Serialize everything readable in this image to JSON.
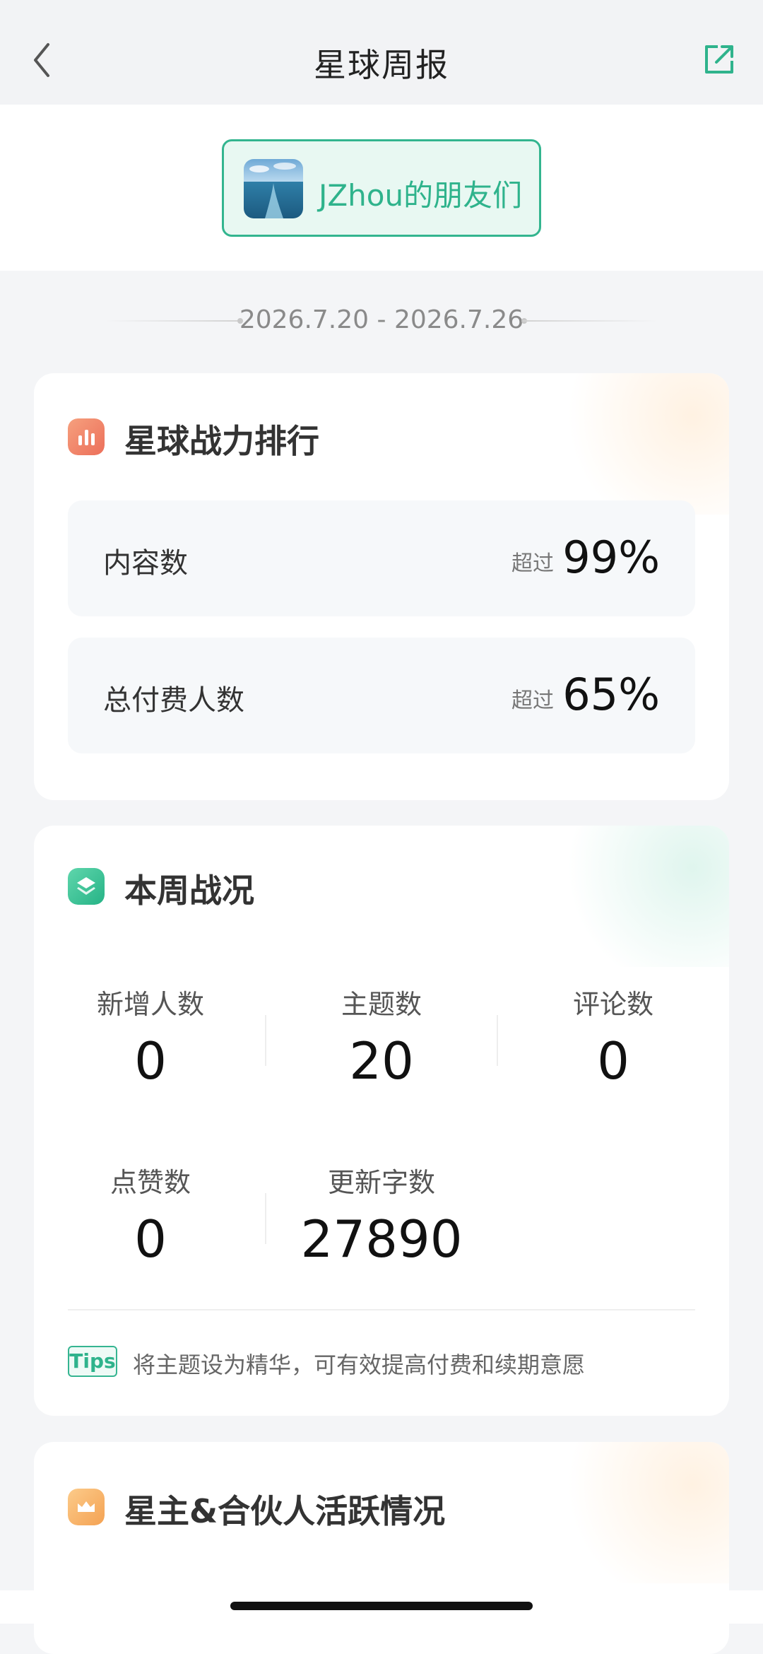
{
  "nav": {
    "title": "星球周报",
    "back_icon": "chevron-left-icon",
    "share_icon": "external-share-icon"
  },
  "planet": {
    "name": "JZhou的朋友们"
  },
  "date_range": "2026.7.20 - 2026.7.26",
  "ranking": {
    "title": "星球战力排行",
    "rows": [
      {
        "label": "内容数",
        "prefix": "超过",
        "value": "99%"
      },
      {
        "label": "总付费人数",
        "prefix": "超过",
        "value": "65%"
      }
    ]
  },
  "weekly": {
    "title": "本周战况",
    "stats": [
      {
        "label": "新增人数",
        "value": "0"
      },
      {
        "label": "主题数",
        "value": "20"
      },
      {
        "label": "评论数",
        "value": "0"
      },
      {
        "label": "点赞数",
        "value": "0"
      },
      {
        "label": "更新字数",
        "value": "27890"
      }
    ],
    "tips_badge": "Tips",
    "tips_text": "将主题设为精华，可有效提高付费和续期意愿"
  },
  "owners": {
    "title": "星主&合伙人活跃情况"
  },
  "colors": {
    "brand_green": "#2fb38c",
    "rank_icon": "#f08a6c",
    "weekly_icon": "#3cc79a",
    "owners_icon": "#f7b36a"
  }
}
